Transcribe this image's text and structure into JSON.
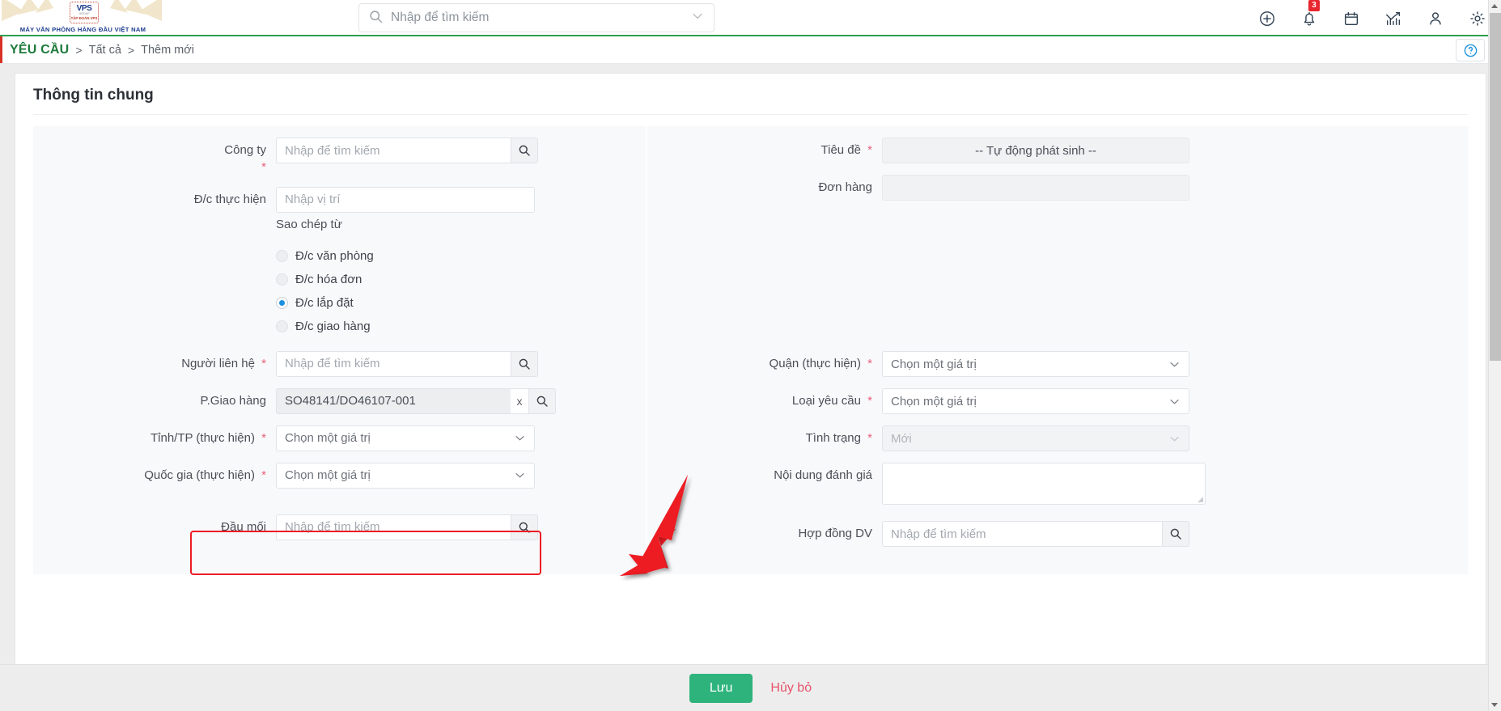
{
  "header": {
    "logo": {
      "badge_text": "VPS",
      "badge_sub": "GROUP",
      "badge_tap": "TẬP ĐOÀN VPS",
      "tagline": "MÁY VĂN PHÒNG HÀNG ĐẦU VIỆT NAM"
    },
    "search": {
      "placeholder": "Nhập để tìm kiếm",
      "value": ""
    },
    "icons": [
      {
        "name": "add-circle-icon",
        "label": "Thêm"
      },
      {
        "name": "bell-icon",
        "label": "Thông báo",
        "badge": "3"
      },
      {
        "name": "calendar-icon",
        "label": "Lịch"
      },
      {
        "name": "chart-icon",
        "label": "Báo cáo"
      },
      {
        "name": "user-icon",
        "label": "Tài khoản"
      },
      {
        "name": "gear-icon",
        "label": "Cài đặt"
      }
    ]
  },
  "breadcrumb": {
    "root": "YÊU CẦU",
    "separator": ">",
    "items": [
      "Tất cả",
      "Thêm mới"
    ],
    "help_label": "?"
  },
  "card": {
    "title": "Thông tin chung"
  },
  "left_fields": {
    "cong_ty": {
      "label": "Công ty",
      "required": "*",
      "placeholder": "Nhập để tìm kiếm",
      "value": ""
    },
    "dc_thuc_hien": {
      "label": "Đ/c thực hiện",
      "placeholder": "Nhập vị trí",
      "value": ""
    },
    "sao_chep_tu": {
      "label": "Sao chép từ"
    },
    "radios": [
      {
        "label": "Đ/c văn phòng",
        "selected": false
      },
      {
        "label": "Đ/c hóa đơn",
        "selected": false
      },
      {
        "label": "Đ/c lắp đặt",
        "selected": true
      },
      {
        "label": "Đ/c giao hàng",
        "selected": false
      }
    ],
    "nguoi_lien_he": {
      "label": "Người liên hệ",
      "required": "*",
      "placeholder": "Nhập để tìm kiếm",
      "value": ""
    },
    "p_giao_hang": {
      "label": "P.Giao hàng",
      "value": "SO48141/DO46107-001",
      "clear_label": "x"
    },
    "tinh_tp": {
      "label": "Tỉnh/TP (thực hiện)",
      "required": "*",
      "value": "Chọn một giá trị"
    },
    "quoc_gia": {
      "label": "Quốc gia (thực hiện)",
      "required": "*",
      "value": "Chọn một giá trị"
    },
    "dau_moi": {
      "label": "Đầu mối",
      "placeholder": "Nhập để tìm kiếm",
      "value": ""
    }
  },
  "right_fields": {
    "tieu_de": {
      "label": "Tiêu đề",
      "required": "*",
      "value": "-- Tự động phát sinh --"
    },
    "don_hang": {
      "label": "Đơn hàng",
      "value": ""
    },
    "quan": {
      "label": "Quận (thực hiện)",
      "required": "*",
      "value": "Chọn một giá trị"
    },
    "loai_yeu_cau": {
      "label": "Loại yêu cầu",
      "required": "*",
      "value": "Chọn một giá trị"
    },
    "tinh_trang": {
      "label": "Tình trạng",
      "required": "*",
      "value": "Mới"
    },
    "noi_dung_danh_gia": {
      "label": "Nội dung đánh giá",
      "value": ""
    },
    "hop_dong_dv": {
      "label": "Hợp đồng DV",
      "placeholder": "Nhập để tìm kiếm",
      "value": ""
    }
  },
  "footer": {
    "save_label": "Lưu",
    "cancel_label": "Hủy bỏ"
  },
  "annotations": {
    "highlight_target": "P.Giao hàng",
    "arrow_color": "#ed1c24",
    "box_color": "#ed1c24"
  },
  "colors": {
    "brand_green": "#2e9e4f",
    "breadcrumb_green": "#1e7a3c",
    "accent_red": "#d93025",
    "save_green": "#2eb37c",
    "cancel_red": "#e8546b",
    "badge_red": "#e8262f",
    "radio_blue": "#1a91e0",
    "help_blue": "#1a91e0"
  }
}
